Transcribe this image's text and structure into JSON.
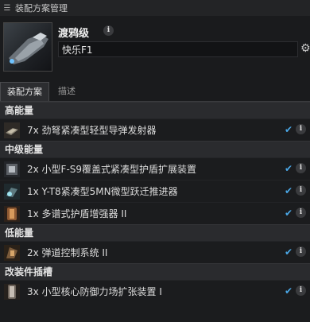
{
  "window": {
    "title": "装配方案管理",
    "menu_icon": "menu-icon"
  },
  "ship": {
    "name": "渡鸦级",
    "fit_name": "快乐F1"
  },
  "tabs": [
    {
      "label": "装配方案",
      "active": true
    },
    {
      "label": "描述",
      "active": false
    }
  ],
  "sections": {
    "high": {
      "title": "高能量",
      "items": [
        {
          "label": "7x 劲弩紧凑型轻型导弹发射器",
          "icon": "missile-launcher-icon"
        }
      ]
    },
    "mid": {
      "title": "中级能量",
      "items": [
        {
          "label": "2x 小型F-S9覆盖式紧凑型护盾扩展装置",
          "icon": "shield-extender-icon"
        },
        {
          "label": "1x Y-T8紧凑型5MN微型跃迁推进器",
          "icon": "microwarpdrive-icon"
        },
        {
          "label": "1x 多谱式护盾增强器 II",
          "icon": "shield-booster-icon"
        }
      ]
    },
    "low": {
      "title": "低能量",
      "items": [
        {
          "label": "2x 弹道控制系统 II",
          "icon": "ballistic-control-icon"
        }
      ]
    },
    "rig": {
      "title": "改装件插槽",
      "items": [
        {
          "label": "3x 小型核心防御力场扩张装置 I",
          "icon": "shield-rig-icon"
        }
      ]
    }
  },
  "colors": {
    "accent_check": "#4aa7e6",
    "section_bg": "#2a2b2e",
    "background": "#1b1c1e"
  }
}
